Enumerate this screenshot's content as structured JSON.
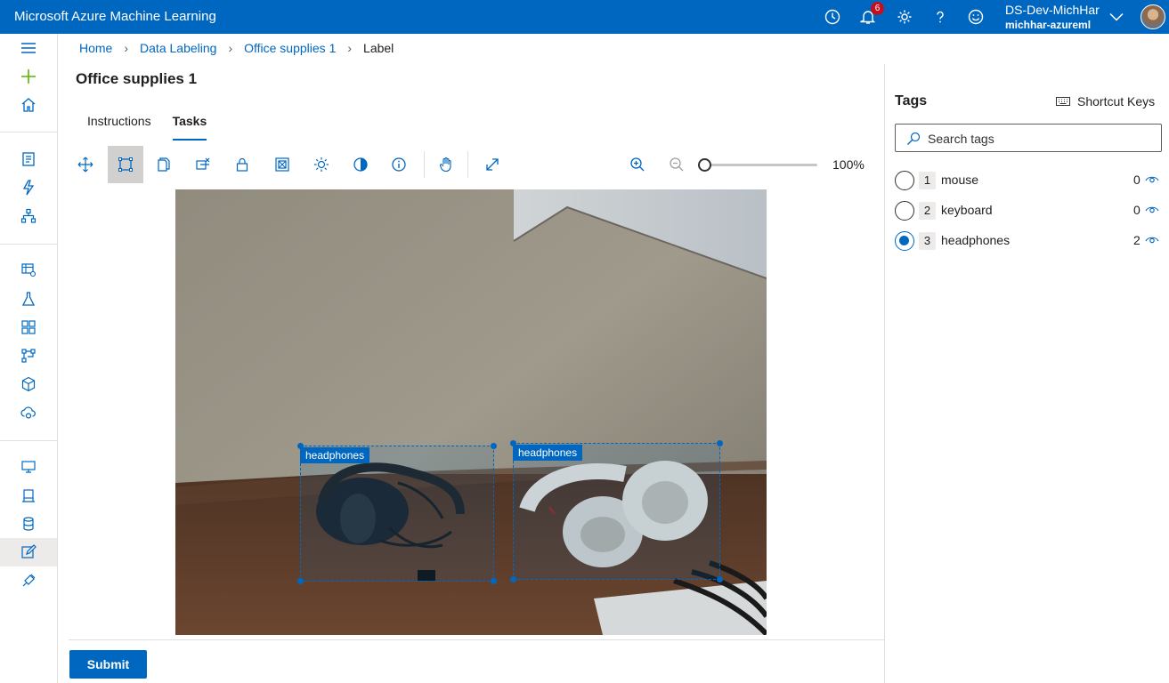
{
  "app": {
    "title": "Microsoft Azure Machine Learning"
  },
  "header": {
    "notification_count": "6",
    "user_name": "DS-Dev-MichHar",
    "workspace": "michhar-azureml",
    "icons": [
      "clock-icon",
      "bell-icon",
      "gear-icon",
      "help-icon",
      "feedback-smiley-icon",
      "chevron-down-icon",
      "avatar"
    ]
  },
  "breadcrumb": {
    "items": [
      "Home",
      "Data Labeling",
      "Office supplies 1"
    ],
    "current": "Label"
  },
  "page": {
    "title": "Office supplies 1"
  },
  "tabs": [
    "Instructions",
    "Tasks"
  ],
  "active_tab": "Tasks",
  "toolbar": {
    "tools": [
      "move-icon",
      "rectangle-select-icon",
      "copy-icon",
      "clear-boxes-icon",
      "lock-icon",
      "regions-icon",
      "brightness-icon",
      "contrast-icon",
      "info-icon",
      "pan-hand-icon",
      "fit-to-screen-icon",
      "zoom-in-icon",
      "zoom-out-icon"
    ],
    "active_tool": "rectangle-select-icon",
    "zoom_label": "100%",
    "zoom_value": 0
  },
  "annotations": [
    {
      "label": "headphones"
    },
    {
      "label": "headphones"
    }
  ],
  "footer": {
    "submit_label": "Submit"
  },
  "tags_panel": {
    "title": "Tags",
    "shortcut_label": "Shortcut Keys",
    "search_placeholder": "Search tags",
    "tags": [
      {
        "key": "1",
        "name": "mouse",
        "count": "0",
        "selected": false
      },
      {
        "key": "2",
        "name": "keyboard",
        "count": "0",
        "selected": false
      },
      {
        "key": "3",
        "name": "headphones",
        "count": "2",
        "selected": true
      }
    ]
  },
  "colors": {
    "accent": "#0067c0",
    "badge": "#c50f1f"
  }
}
